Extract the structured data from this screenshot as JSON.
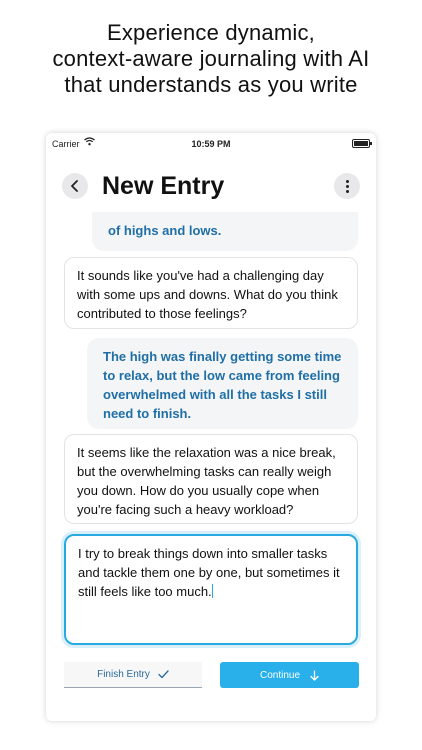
{
  "promo": {
    "line1": "Experience dynamic,",
    "line2": "context-aware journaling with AI",
    "line3": "that understands as you write"
  },
  "status_bar": {
    "carrier": "Carrier",
    "time": "10:59 PM"
  },
  "header": {
    "title": "New Entry"
  },
  "messages": [
    {
      "role": "user",
      "text": "of highs and lows."
    },
    {
      "role": "ai",
      "text": "It sounds like you've had a challenging day with some ups and downs. What do you think contributed to those feelings?"
    },
    {
      "role": "user",
      "text": "The high was finally getting some time to relax, but the low came from feeling overwhelmed with all the tasks I still need to finish."
    },
    {
      "role": "ai",
      "text": "It seems like the relaxation was a nice break, but the overwhelming tasks can really weigh you down. How do you usually cope when you're facing such a heavy workload?"
    }
  ],
  "composer": {
    "value": "I try to break things down into smaller tasks and tackle them one by one, but sometimes it still feels like too much."
  },
  "actions": {
    "finish_label": "Finish Entry",
    "continue_label": "Continue"
  },
  "colors": {
    "accent": "#29b0ea",
    "user_text": "#1f6fa6"
  }
}
